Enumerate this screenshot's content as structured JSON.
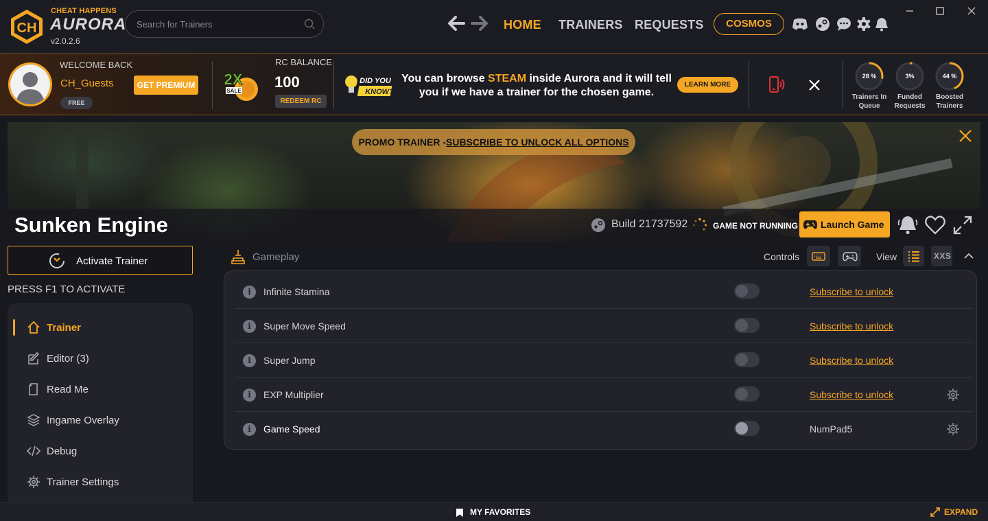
{
  "app": {
    "brand_top": "CHEAT HAPPENS",
    "brand_name": "AURORA",
    "version": "v2.0.2.6"
  },
  "search": {
    "placeholder": "Search for Trainers"
  },
  "nav": {
    "items": [
      "HOME",
      "TRAINERS",
      "REQUESTS"
    ],
    "active": "HOME",
    "cosmos": "COSMOS"
  },
  "user_strip": {
    "welcome": "WELCOME BACK",
    "username": "CH_Guests",
    "tier": "FREE",
    "get_premium": "GET PREMIUM",
    "sale_badge": "2X SALE",
    "rc_label": "RC BALANCE",
    "rc_value": "100",
    "redeem": "REDEEM RC",
    "did_you_know": "DID YOU KNOW?",
    "tip_pre": "You can browse ",
    "tip_highlight": "STEAM",
    "tip_post": " inside Aurora and it will tell you if we have a trainer for the chosen game.",
    "learn_more": "LEARN MORE"
  },
  "stats": [
    {
      "value": "28 %",
      "pct": 28,
      "label_1": "Trainers In",
      "label_2": "Queue"
    },
    {
      "value": "3%",
      "pct": 3,
      "label_1": "Funded",
      "label_2": "Requests"
    },
    {
      "value": "44 %",
      "pct": 44,
      "label_1": "Boosted",
      "label_2": "Trainers"
    }
  ],
  "banner": {
    "promo_prefix": "PROMO TRAINER -",
    "promo_link": "SUBSCRIBE TO UNLOCK ALL OPTIONS",
    "game_title": "Sunken Engine",
    "build": "Build 21737592",
    "status": "GAME NOT RUNNING",
    "launch": "Launch Game"
  },
  "left": {
    "activate": "Activate Trainer",
    "hint": "PRESS F1 TO ACTIVATE",
    "menu": [
      {
        "label": "Trainer",
        "icon": "home-icon",
        "active": true
      },
      {
        "label": "Editor (3)",
        "icon": "edit-icon",
        "active": false
      },
      {
        "label": "Read Me",
        "icon": "document-icon",
        "active": false
      },
      {
        "label": "Ingame Overlay",
        "icon": "layers-icon",
        "active": false
      },
      {
        "label": "Debug",
        "icon": "code-icon",
        "active": false
      },
      {
        "label": "Trainer Settings",
        "icon": "gear-icon",
        "active": false
      }
    ]
  },
  "options": {
    "section": "Gameplay",
    "controls_label": "Controls",
    "view_label": "View",
    "view_xxs": "XXS",
    "rows": [
      {
        "name": "Infinite Stamina",
        "action": "Subscribe to unlock",
        "locked": true,
        "gear": false
      },
      {
        "name": "Super Move Speed",
        "action": "Subscribe to unlock",
        "locked": true,
        "gear": false
      },
      {
        "name": "Super Jump",
        "action": "Subscribe to unlock",
        "locked": true,
        "gear": false
      },
      {
        "name": "EXP Multiplier",
        "action": "Subscribe to unlock",
        "locked": true,
        "gear": true
      },
      {
        "name": "Game Speed",
        "action": "NumPad5",
        "locked": false,
        "gear": true
      }
    ]
  },
  "footer": {
    "favorites": "MY FAVORITES",
    "expand": "EXPAND"
  },
  "colors": {
    "accent": "#f5a623",
    "background": "#18181f",
    "panel": "#22222b"
  }
}
